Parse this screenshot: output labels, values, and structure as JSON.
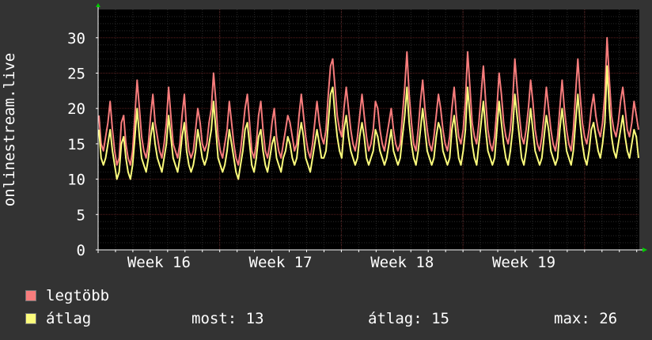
{
  "colors": {
    "background": "#333333",
    "plot_background": "#000000",
    "grid_minor": "#2a2a2a",
    "grid_major": "#5a1f1f",
    "axis": "#ffffff",
    "arrow": "#00cc00",
    "max_series": "#f77c7c",
    "avg_series": "#fcfc7c"
  },
  "chart_data": {
    "type": "line",
    "ylabel": "onlinestream.live",
    "ylim": [
      0,
      34
    ],
    "yticks": [
      0,
      5,
      10,
      15,
      20,
      25,
      30
    ],
    "xlim": [
      0,
      4.45
    ],
    "xticks": [
      {
        "x": 0.5,
        "label": "Week 16"
      },
      {
        "x": 1.5,
        "label": "Week 17"
      },
      {
        "x": 2.5,
        "label": "Week 18"
      },
      {
        "x": 3.5,
        "label": "Week 19"
      }
    ],
    "grid": true,
    "legend_position": "bottom-left",
    "series": [
      {
        "name": "legtöbb",
        "color": "#f77c7c",
        "values": [
          19,
          15,
          14,
          16,
          18,
          21,
          17,
          14,
          12,
          13,
          18,
          19,
          15,
          13,
          12,
          14,
          19,
          24,
          20,
          16,
          14,
          13,
          15,
          19,
          22,
          18,
          16,
          14,
          13,
          15,
          18,
          23,
          19,
          15,
          14,
          13,
          15,
          19,
          22,
          17,
          14,
          13,
          14,
          17,
          20,
          18,
          15,
          14,
          15,
          18,
          20,
          25,
          21,
          16,
          14,
          13,
          15,
          17,
          21,
          18,
          15,
          13,
          12,
          14,
          17,
          20,
          22,
          18,
          14,
          13,
          15,
          19,
          21,
          17,
          14,
          13,
          15,
          18,
          20,
          16,
          14,
          13,
          15,
          17,
          19,
          18,
          16,
          14,
          15,
          19,
          22,
          19,
          16,
          14,
          13,
          15,
          18,
          21,
          18,
          16,
          15,
          17,
          22,
          26,
          27,
          23,
          19,
          17,
          16,
          20,
          23,
          20,
          17,
          15,
          14,
          16,
          19,
          22,
          19,
          16,
          14,
          15,
          17,
          21,
          20,
          17,
          15,
          14,
          16,
          18,
          20,
          17,
          15,
          14,
          15,
          19,
          23,
          28,
          22,
          18,
          15,
          14,
          17,
          21,
          24,
          20,
          17,
          15,
          14,
          16,
          19,
          22,
          20,
          17,
          15,
          14,
          16,
          20,
          23,
          19,
          16,
          15,
          17,
          21,
          28,
          23,
          18,
          16,
          15,
          18,
          22,
          26,
          21,
          17,
          15,
          14,
          16,
          20,
          25,
          22,
          18,
          16,
          15,
          17,
          21,
          27,
          23,
          19,
          16,
          15,
          17,
          20,
          24,
          21,
          17,
          15,
          14,
          16,
          19,
          23,
          20,
          17,
          15,
          14,
          16,
          20,
          24,
          20,
          17,
          15,
          14,
          17,
          22,
          27,
          22,
          18,
          16,
          15,
          17,
          20,
          22,
          19,
          17,
          16,
          18,
          22,
          30,
          24,
          19,
          17,
          16,
          18,
          21,
          23,
          20,
          17,
          16,
          18,
          21,
          19,
          17
        ]
      },
      {
        "name": "átlag",
        "color": "#fcfc7c",
        "values": [
          17,
          13,
          12,
          13,
          15,
          17,
          14,
          12,
          10,
          11,
          15,
          16,
          13,
          11,
          10,
          12,
          16,
          20,
          16,
          13,
          12,
          11,
          13,
          16,
          18,
          15,
          13,
          12,
          11,
          13,
          15,
          19,
          16,
          13,
          12,
          11,
          13,
          16,
          18,
          14,
          12,
          11,
          12,
          14,
          17,
          15,
          13,
          12,
          13,
          15,
          17,
          21,
          17,
          13,
          12,
          11,
          12,
          14,
          17,
          15,
          13,
          11,
          10,
          12,
          14,
          17,
          18,
          15,
          12,
          11,
          13,
          16,
          17,
          14,
          12,
          11,
          13,
          15,
          16,
          13,
          12,
          11,
          13,
          14,
          16,
          15,
          13,
          12,
          13,
          16,
          18,
          16,
          13,
          12,
          11,
          13,
          15,
          17,
          15,
          13,
          13,
          14,
          18,
          22,
          23,
          19,
          16,
          14,
          13,
          17,
          19,
          16,
          14,
          13,
          12,
          13,
          16,
          18,
          16,
          13,
          12,
          13,
          14,
          17,
          16,
          14,
          13,
          12,
          13,
          15,
          17,
          14,
          13,
          12,
          13,
          16,
          19,
          23,
          18,
          15,
          13,
          12,
          14,
          17,
          20,
          17,
          14,
          13,
          12,
          13,
          16,
          18,
          17,
          14,
          13,
          12,
          13,
          17,
          19,
          16,
          13,
          12,
          14,
          17,
          23,
          19,
          15,
          13,
          12,
          15,
          18,
          21,
          17,
          14,
          13,
          12,
          13,
          17,
          21,
          18,
          15,
          13,
          12,
          14,
          17,
          22,
          19,
          16,
          13,
          12,
          14,
          17,
          20,
          17,
          14,
          13,
          12,
          13,
          16,
          19,
          17,
          14,
          13,
          12,
          13,
          17,
          20,
          17,
          14,
          13,
          12,
          14,
          18,
          22,
          18,
          15,
          13,
          12,
          14,
          17,
          18,
          16,
          14,
          13,
          15,
          18,
          26,
          20,
          16,
          14,
          13,
          15,
          17,
          19,
          16,
          14,
          13,
          15,
          17,
          16,
          13
        ]
      }
    ]
  },
  "legend": {
    "items": [
      {
        "label": "legtöbb",
        "color": "#f77c7c"
      },
      {
        "label": "átlag",
        "color": "#fcfc7c"
      }
    ],
    "stats": {
      "now": "most: 13",
      "avg": "átlag: 15",
      "max": "max: 26"
    }
  }
}
